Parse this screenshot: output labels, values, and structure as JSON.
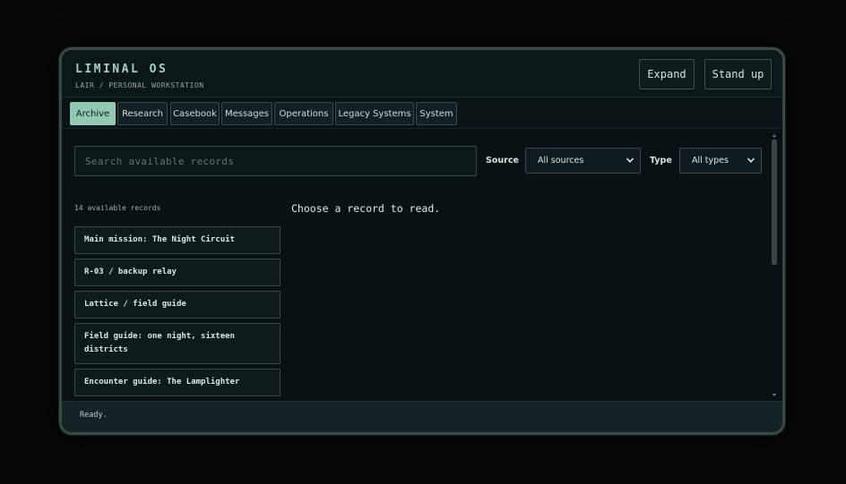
{
  "app": {
    "title": "LIMINAL OS",
    "subtitle": "LAIR / PERSONAL WORKSTATION"
  },
  "header": {
    "expand_label": "Expand",
    "standup_label": "Stand up"
  },
  "tabs": [
    {
      "label": "Archive",
      "active": true
    },
    {
      "label": "Research",
      "active": false
    },
    {
      "label": "Casebook",
      "active": false
    },
    {
      "label": "Messages",
      "active": false
    },
    {
      "label": "Operations",
      "active": false
    },
    {
      "label": "Legacy Systems",
      "active": false
    },
    {
      "label": "System",
      "active": false
    }
  ],
  "filters": {
    "search_placeholder": "Search available records",
    "source_label": "Source",
    "source_value": "All sources",
    "type_label": "Type",
    "type_value": "All types"
  },
  "records": {
    "count_text": "14 available records",
    "items": [
      "Main mission: The Night Circuit",
      "R-03 / backup relay",
      "Lattice / field guide",
      "Field guide: one night, sixteen districts",
      "Encounter guide: The Lamplighter"
    ]
  },
  "reader": {
    "empty_text": "Choose a record to read."
  },
  "status": {
    "text": "Ready."
  },
  "colors": {
    "accent": "#93c9b2",
    "background": "#081113",
    "panel": "#0f1a1c",
    "border": "#394846"
  }
}
